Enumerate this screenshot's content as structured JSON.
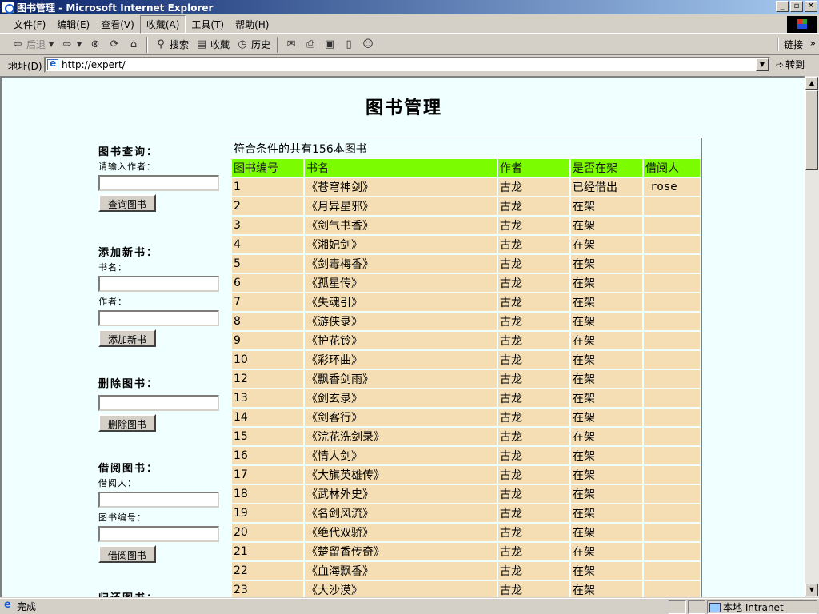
{
  "window": {
    "title": "图书管理 - Microsoft Internet Explorer",
    "min": "_",
    "max": "▫",
    "close": "✕"
  },
  "menu": [
    "文件(F)",
    "编辑(E)",
    "查看(V)",
    "收藏(A)",
    "工具(T)",
    "帮助(H)"
  ],
  "toolbar": {
    "back": "后退",
    "forward": "",
    "stop": "",
    "refresh": "",
    "home": "",
    "search": "搜索",
    "favorites": "收藏",
    "history": "历史",
    "links": "链接",
    "more": "»"
  },
  "address": {
    "label": "地址(D)",
    "value": "http://expert/",
    "go": "转到"
  },
  "page": {
    "title": "图书管理"
  },
  "sidebar": {
    "query": {
      "heading": "图书查询：",
      "author_label": "请输入作者：",
      "button": "查询图书"
    },
    "add": {
      "heading": "添加新书：",
      "name_label": "书名：",
      "author_label": "作者：",
      "button": "添加新书"
    },
    "delete": {
      "heading": "删除图书：",
      "button": "删除图书"
    },
    "borrow": {
      "heading": "借阅图书：",
      "borrower_label": "借阅人：",
      "id_label": "图书编号：",
      "button": "借阅图书"
    },
    "return": {
      "heading": "归还图书："
    }
  },
  "table": {
    "summary": "符合条件的共有156本图书",
    "headers": [
      "图书编号",
      "书名",
      "作者",
      "是否在架",
      "借阅人"
    ],
    "rows": [
      [
        "1",
        "《苍穹神剑》",
        "古龙",
        "已经借出",
        "rose"
      ],
      [
        "2",
        "《月异星邪》",
        "古龙",
        "在架",
        ""
      ],
      [
        "3",
        "《剑气书香》",
        "古龙",
        "在架",
        ""
      ],
      [
        "4",
        "《湘妃剑》",
        "古龙",
        "在架",
        ""
      ],
      [
        "5",
        "《剑毒梅香》",
        "古龙",
        "在架",
        ""
      ],
      [
        "6",
        "《孤星传》",
        "古龙",
        "在架",
        ""
      ],
      [
        "7",
        "《失魂引》",
        "古龙",
        "在架",
        ""
      ],
      [
        "8",
        "《游侠录》",
        "古龙",
        "在架",
        ""
      ],
      [
        "9",
        "《护花铃》",
        "古龙",
        "在架",
        ""
      ],
      [
        "10",
        "《彩环曲》",
        "古龙",
        "在架",
        ""
      ],
      [
        "12",
        "《飘香剑雨》",
        "古龙",
        "在架",
        ""
      ],
      [
        "13",
        "《剑玄录》",
        "古龙",
        "在架",
        ""
      ],
      [
        "14",
        "《剑客行》",
        "古龙",
        "在架",
        ""
      ],
      [
        "15",
        "《浣花洗剑录》",
        "古龙",
        "在架",
        ""
      ],
      [
        "16",
        "《情人剑》",
        "古龙",
        "在架",
        ""
      ],
      [
        "17",
        "《大旗英雄传》",
        "古龙",
        "在架",
        ""
      ],
      [
        "18",
        "《武林外史》",
        "古龙",
        "在架",
        ""
      ],
      [
        "19",
        "《名剑风流》",
        "古龙",
        "在架",
        ""
      ],
      [
        "20",
        "《绝代双骄》",
        "古龙",
        "在架",
        ""
      ],
      [
        "21",
        "《楚留香传奇》",
        "古龙",
        "在架",
        ""
      ],
      [
        "22",
        "《血海飘香》",
        "古龙",
        "在架",
        ""
      ],
      [
        "23",
        "《大沙漠》",
        "古龙",
        "在架",
        ""
      ]
    ]
  },
  "status": {
    "text": "完成",
    "zone": "本地 Intranet"
  }
}
